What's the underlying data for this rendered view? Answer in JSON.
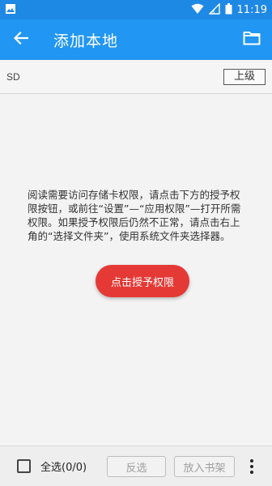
{
  "status_bar": {
    "time": "11:19"
  },
  "app_bar": {
    "title": "添加本地"
  },
  "path_bar": {
    "path": "SD",
    "up_label": "上级"
  },
  "content": {
    "message": "阅读需要访问存储卡权限，请点击下方的授予权限按钮，或前往“设置”—“应用权限”—打开所需权限。如果授予权限后仍然不正常，请点击右上角的“选择文件夹”，使用系统文件夹选择器。",
    "grant_button": "点击授予权限"
  },
  "bottom_bar": {
    "select_all": "全选(0/0)",
    "invert": "反选",
    "add_to_shelf": "放入书架"
  },
  "colors": {
    "status_bar": "#1e88e5",
    "app_bar": "#2196f3",
    "accent_button": "#e53935"
  }
}
